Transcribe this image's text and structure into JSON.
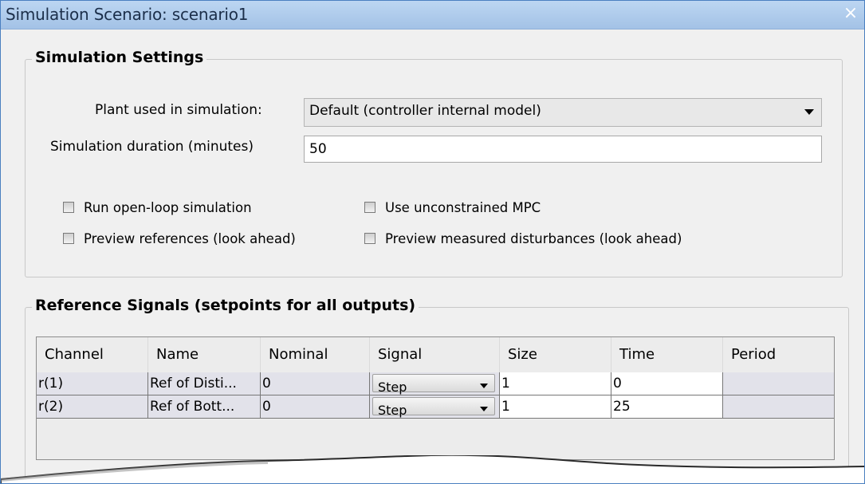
{
  "window": {
    "title": "Simulation Scenario: scenario1",
    "close_glyph": "×"
  },
  "simulation_settings": {
    "group_title": "Simulation Settings",
    "plant_label": "Plant used in simulation:",
    "plant_value": "Default (controller internal model)",
    "duration_label": "Simulation duration (minutes)",
    "duration_value": "50",
    "options": {
      "open_loop": "Run open-loop simulation",
      "unconstrained": "Use unconstrained MPC",
      "preview_refs": "Preview references (look ahead)",
      "preview_md": "Preview measured disturbances (look ahead)"
    }
  },
  "reference_signals": {
    "group_title": "Reference Signals (setpoints for all outputs)",
    "columns": [
      "Channel",
      "Name",
      "Nominal",
      "Signal",
      "Size",
      "Time",
      "Period"
    ],
    "rows": [
      {
        "channel": "r(1)",
        "name": "Ref of Disti...",
        "nominal": "0",
        "signal": "Step",
        "size": "1",
        "time": "0",
        "period": ""
      },
      {
        "channel": "r(2)",
        "name": "Ref of Bott...",
        "nominal": "0",
        "signal": "Step",
        "size": "1",
        "time": "25",
        "period": ""
      }
    ]
  },
  "colors": {
    "title_bar": "#bcd6f2",
    "panel_bg": "#f0f0f0",
    "editable_cell": "#ffffff",
    "readonly_cell": "#e2e2ea"
  }
}
